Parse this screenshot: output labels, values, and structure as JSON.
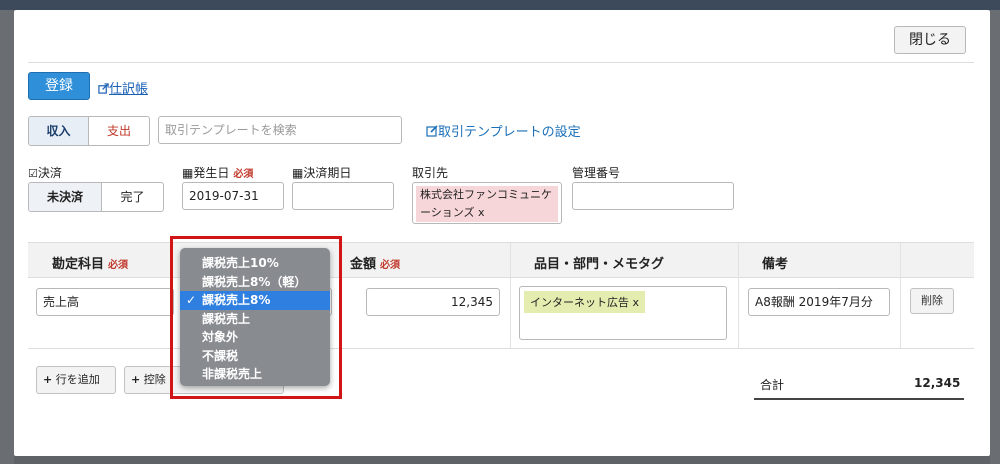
{
  "modal": {
    "close_label": "閉じる",
    "register_label": "登録",
    "journal_link": "仕訳帳"
  },
  "form": {
    "income_label": "収入",
    "expense_label": "支出",
    "template_search_placeholder": "取引テンプレートを検索",
    "template_settings_link": "取引テンプレートの設定",
    "settlement_label": "決済",
    "unsettled_label": "未決済",
    "settled_label": "完了",
    "issue_date_label": "発生日",
    "required_label": "必須",
    "issue_date_value": "2019-07-31",
    "due_date_label": "決済期日",
    "partner_label": "取引先",
    "partner_tag": "株式会社ファンコミュニケーションズ x",
    "control_number_label": "管理番号"
  },
  "table": {
    "headers": {
      "account": "勘定科目",
      "amount": "金額",
      "item_tags": "品目・部門・メモタグ",
      "remarks": "備考"
    },
    "row": {
      "account": "売上高",
      "amount": "12,345",
      "tag": "インターネット広告 x",
      "remarks": "A8報酬 2019年7月分",
      "delete_label": "削除"
    },
    "add_row_label": "行を追加",
    "deduction_label": "控除・",
    "total_label": "合計",
    "total_value": "12,345"
  },
  "dropdown": {
    "items": [
      "課税売上10%",
      "課税売上8%（軽）",
      "課税売上8%",
      "課税売上",
      "対象外",
      "不課税",
      "非課税売上"
    ],
    "selected": "課税売上8%",
    "check_mark": "✓"
  },
  "icons": {
    "journal_link_icon": "external-link-icon",
    "template_link_icon": "edit-icon",
    "settlement_icon": "checkbox-icon",
    "calendar_icon": "calendar-icon",
    "plus_icon": "plus-icon"
  },
  "colors": {
    "accent": "#2f8fd8",
    "required": "#c0392b",
    "highlight_frame": "#d11414",
    "dropdown_selected": "#2f7fe0"
  }
}
